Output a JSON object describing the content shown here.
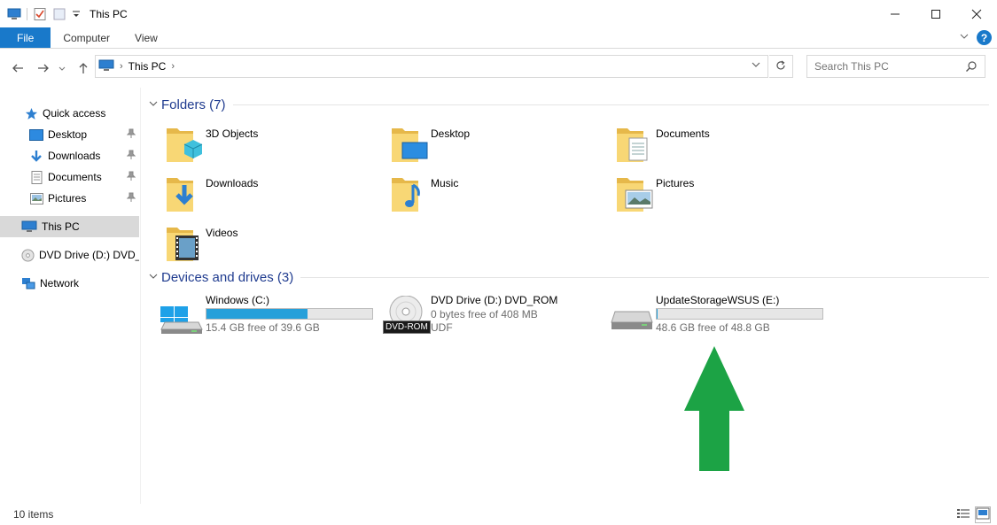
{
  "window": {
    "title": "This PC",
    "controls": {
      "minimize": "—",
      "maximize": "☐",
      "close": "✕"
    }
  },
  "ribbon": {
    "tabs": [
      "File",
      "Computer",
      "View"
    ],
    "help": "?"
  },
  "address": {
    "breadcrumb": "This PC",
    "search_placeholder": "Search This PC"
  },
  "sidebar": {
    "items": [
      {
        "label": "Quick access",
        "icon": "star-icon"
      },
      {
        "label": "Desktop",
        "icon": "desktop-icon",
        "pinned": true
      },
      {
        "label": "Downloads",
        "icon": "download-icon",
        "pinned": true
      },
      {
        "label": "Documents",
        "icon": "document-icon",
        "pinned": true
      },
      {
        "label": "Pictures",
        "icon": "pictures-icon",
        "pinned": true
      },
      {
        "label": "This PC",
        "icon": "computer-icon",
        "selected": true
      },
      {
        "label": "DVD Drive (D:) DVD_R",
        "icon": "dvd-icon"
      },
      {
        "label": "Network",
        "icon": "network-icon"
      }
    ]
  },
  "folders": {
    "header": "Folders (7)",
    "items": [
      {
        "label": "3D Objects",
        "icon": "3d-objects-folder-icon"
      },
      {
        "label": "Desktop",
        "icon": "desktop-folder-icon"
      },
      {
        "label": "Documents",
        "icon": "documents-folder-icon"
      },
      {
        "label": "Downloads",
        "icon": "downloads-folder-icon"
      },
      {
        "label": "Music",
        "icon": "music-folder-icon"
      },
      {
        "label": "Pictures",
        "icon": "pictures-folder-icon"
      },
      {
        "label": "Videos",
        "icon": "videos-folder-icon"
      }
    ]
  },
  "drives": {
    "header": "Devices and drives (3)",
    "items": [
      {
        "name": "Windows (C:)",
        "free": "15.4 GB free of 39.6 GB",
        "used_fraction": 0.611,
        "icon": "windows-drive-icon"
      },
      {
        "name": "DVD Drive (D:) DVD_ROM",
        "line1": "0 bytes free of 408 MB",
        "line2": "UDF",
        "badge": "DVD-ROM",
        "icon": "dvd-drive-icon"
      },
      {
        "name": "UpdateStorageWSUS (E:)",
        "free": "48.6 GB free of 48.8 GB",
        "used_fraction": 0.004,
        "icon": "hard-drive-icon"
      }
    ]
  },
  "status": {
    "items": "10 items"
  },
  "colors": {
    "accent": "#1979ca",
    "drive_bar": "#26a0da",
    "arrow": "#1ca345",
    "header_text": "#1f3b8f"
  }
}
